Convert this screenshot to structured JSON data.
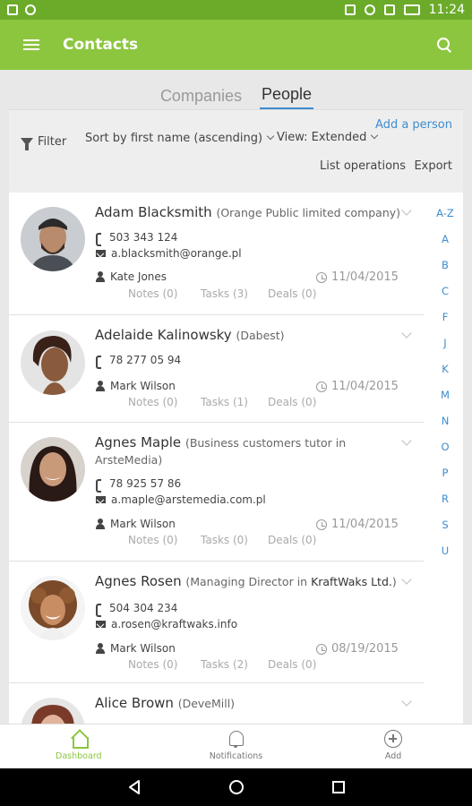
{
  "status_bar": {
    "time": "11:24"
  },
  "app_bar": {
    "title": "Contacts"
  },
  "tabs": [
    {
      "label": "Companies",
      "active": false
    },
    {
      "label": "People",
      "active": true
    }
  ],
  "toolbar": {
    "filter_label": "Filter",
    "sort_label": "Sort by first name (ascending)",
    "view_label": "View: Extended",
    "add_label": "Add a person",
    "list_operations_label": "List operations",
    "export_label": "Export"
  },
  "contacts": [
    {
      "name": "Adam Blacksmith",
      "company": "(Orange Public limited company)",
      "phone": "503 343 124",
      "email": "a.blacksmith@orange.pl",
      "owner": "Kate Jones",
      "date": "11/04/2015",
      "notes": "Notes (0)",
      "tasks": "Tasks (3)",
      "deals": "Deals (0)"
    },
    {
      "name": "Adelaide Kalinowsky",
      "company": "(Dabest)",
      "phone": "78 277 05 94",
      "email": "",
      "owner": "Mark Wilson",
      "date": "11/04/2015",
      "notes": "Notes (0)",
      "tasks": "Tasks (1)",
      "deals": "Deals (0)"
    },
    {
      "name": "Agnes Maple",
      "company": "(Business customers tutor in ArsteMedia)",
      "phone": "78 925 57 86",
      "email": "a.maple@arstemedia.com.pl",
      "owner": "Mark Wilson",
      "date": "11/04/2015",
      "notes": "Notes (0)",
      "tasks": "Tasks (0)",
      "deals": "Deals (0)"
    },
    {
      "name": "Agnes Rosen",
      "company_prefix": "(Managing Director in ",
      "company_strong": "KraftWaks Ltd.",
      "company_suffix": ")",
      "phone": "504 304 234",
      "email": "a.rosen@kraftwaks.info",
      "owner": "Mark Wilson",
      "date": "08/19/2015",
      "notes": "Notes (0)",
      "tasks": "Tasks (2)",
      "deals": "Deals (0)"
    },
    {
      "name": "Alice Brown",
      "company": "(DeveMill)"
    }
  ],
  "alphabet": [
    "A-Z",
    "A",
    "B",
    "C",
    "F",
    "J",
    "K",
    "M",
    "N",
    "O",
    "P",
    "R",
    "S",
    "U"
  ],
  "bottom_nav": [
    {
      "label": "Dashboard",
      "icon": "house-icon",
      "active": true
    },
    {
      "label": "Notifications",
      "icon": "bell-icon",
      "active": false
    },
    {
      "label": "Add",
      "icon": "plus-circle-icon",
      "active": false
    }
  ],
  "colors": {
    "brand_green": "#8cc63f",
    "status_green": "#6cab2a",
    "link_blue": "#3d8ccf"
  }
}
